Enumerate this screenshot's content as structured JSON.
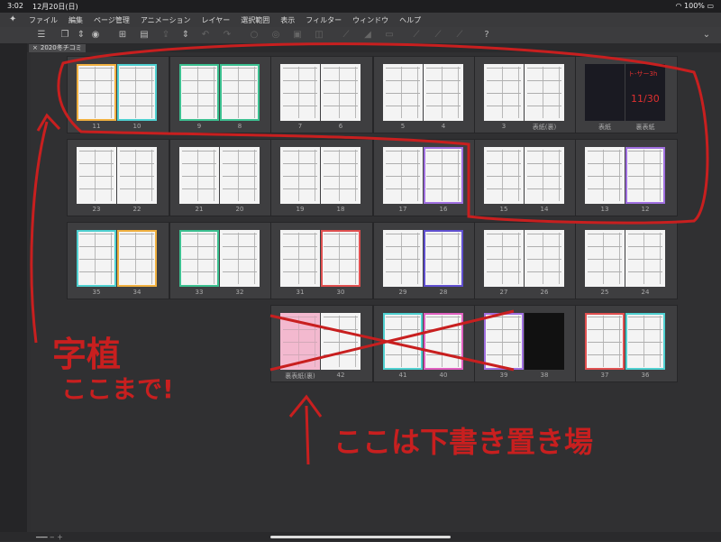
{
  "status": {
    "time": "3:02",
    "date": "12月20日(日)",
    "battery": "100%"
  },
  "menu": [
    "ファイル",
    "編集",
    "ページ管理",
    "アニメーション",
    "レイヤー",
    "選択範囲",
    "表示",
    "フィルター",
    "ウィンドウ",
    "ヘルプ"
  ],
  "tab": {
    "close": "×",
    "label": "2020冬チコミ"
  },
  "spreads": [
    {
      "left": "11",
      "right": "10",
      "leftColor": "#f0b040",
      "rightColor": "#4fd0d0"
    },
    {
      "left": "9",
      "right": "8",
      "leftColor": "#3cc090",
      "rightColor": "#3cc090"
    },
    {
      "left": "7",
      "right": "6",
      "leftColor": "",
      "rightColor": ""
    },
    {
      "left": "5",
      "right": "4",
      "leftColor": "",
      "rightColor": ""
    },
    {
      "left": "3",
      "right": "表紙(裏)",
      "leftColor": "",
      "rightColor": ""
    },
    {
      "left": "表紙",
      "right": "裏表紙",
      "leftColor": "",
      "rightColor": ""
    },
    {
      "left": "23",
      "right": "22",
      "leftColor": "",
      "rightColor": ""
    },
    {
      "left": "21",
      "right": "20",
      "leftColor": "",
      "rightColor": ""
    },
    {
      "left": "19",
      "right": "18",
      "leftColor": "",
      "rightColor": ""
    },
    {
      "left": "17",
      "right": "16",
      "leftColor": "",
      "rightColor": "#a070e0"
    },
    {
      "left": "15",
      "right": "14",
      "leftColor": "",
      "rightColor": ""
    },
    {
      "left": "13",
      "right": "12",
      "leftColor": "",
      "rightColor": "#a070e0"
    },
    {
      "left": "35",
      "right": "34",
      "leftColor": "#4fd0d0",
      "rightColor": "#f0b040"
    },
    {
      "left": "33",
      "right": "32",
      "leftColor": "#3cc090",
      "rightColor": ""
    },
    {
      "left": "31",
      "right": "30",
      "leftColor": "",
      "rightColor": "#e05050"
    },
    {
      "left": "29",
      "right": "28",
      "leftColor": "",
      "rightColor": "#6050d0"
    },
    {
      "left": "27",
      "right": "26",
      "leftColor": "",
      "rightColor": ""
    },
    {
      "left": "25",
      "right": "24",
      "leftColor": "",
      "rightColor": ""
    },
    {
      "left": "裏表紙(裏)",
      "right": "42",
      "leftColor": "",
      "rightColor": ""
    },
    {
      "left": "41",
      "right": "40",
      "leftColor": "#4fd0d0",
      "rightColor": "#e060c0"
    },
    {
      "left": "39",
      "right": "38",
      "leftColor": "#a070e0",
      "rightColor": ""
    },
    {
      "left": "37",
      "right": "36",
      "leftColor": "#e05050",
      "rightColor": "#4fd0d0"
    }
  ],
  "cover": {
    "line1": "ト-サー3h",
    "line2": "11/30"
  },
  "annotations": {
    "a1": "字植",
    "a2": "ここまで!",
    "a3": "ここは下書き置き場"
  },
  "colors": {
    "annotation": "#c81f1f"
  }
}
